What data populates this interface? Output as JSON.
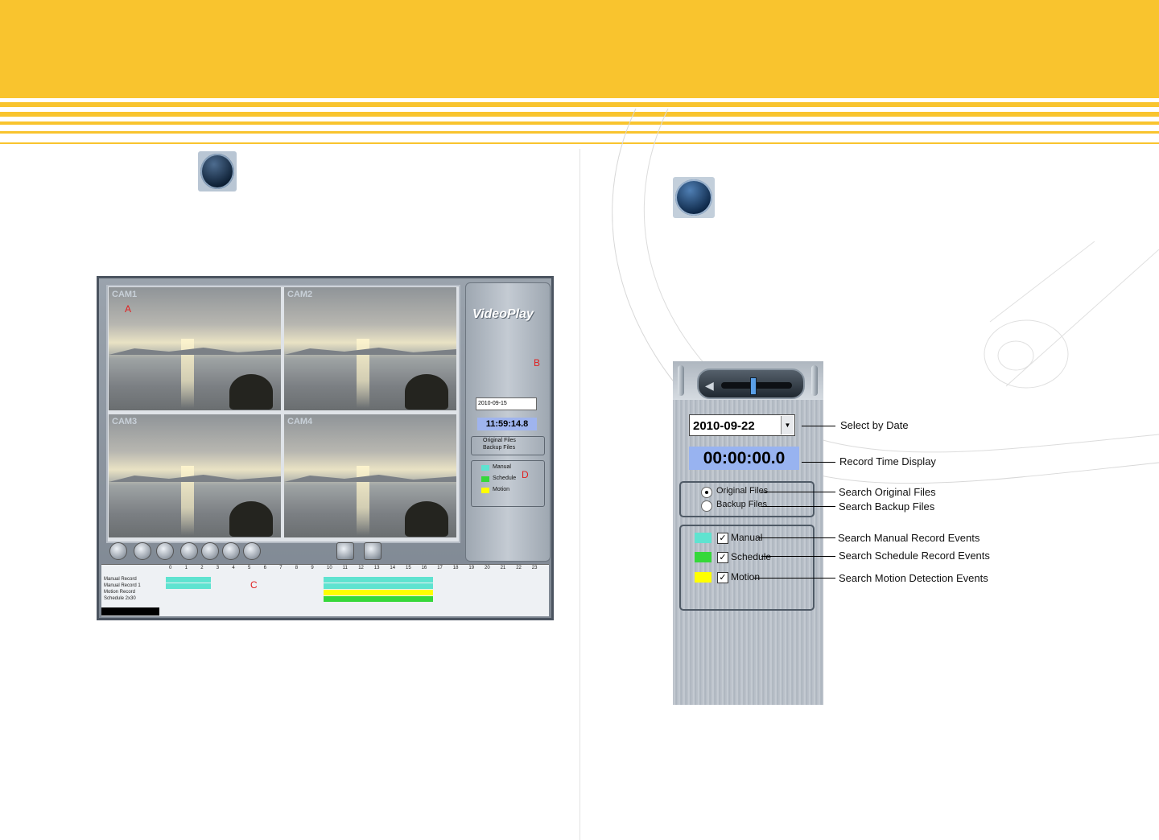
{
  "colors": {
    "header": "#f9c42e",
    "manual": "#5fe3d0",
    "schedule": "#35d83a",
    "motion": "#ffff00",
    "time_bg": "#98b3f0"
  },
  "icons": {
    "search": "playback-search-icon",
    "back": "return-icon"
  },
  "screenshot": {
    "cameras": [
      "CAM1",
      "CAM2",
      "CAM3",
      "CAM4"
    ],
    "logo": "VideoPlay",
    "date": "2010-09-15",
    "time": "11:59:14.8",
    "files": [
      "Original Files",
      "Backup Files"
    ],
    "events": [
      "Manual",
      "Schedule",
      "Motion"
    ],
    "timeline_rows": [
      "Manual Record",
      "Manual Record 1",
      "Motion Record",
      "Schedule 2x30"
    ],
    "hours": [
      "0",
      "1",
      "2",
      "3",
      "4",
      "5",
      "6",
      "7",
      "8",
      "9",
      "10",
      "11",
      "12",
      "13",
      "14",
      "15",
      "16",
      "17",
      "18",
      "19",
      "20",
      "21",
      "22",
      "23"
    ],
    "markers": {
      "a": "A",
      "b": "B",
      "c": "C",
      "d": "D"
    }
  },
  "panel": {
    "date": "2010-09-22",
    "time": "00:00:00.0",
    "original": "Original Files",
    "backup": "Backup Files",
    "manual": "Manual",
    "schedule": "Schedule",
    "motion": "Motion",
    "check": "✓"
  },
  "callouts": {
    "select_date": "Select by Date",
    "record_time": "Record Time Display",
    "search_original": "Search Original Files",
    "search_backup": "Search Backup Files",
    "search_manual": "Search Manual Record Events",
    "search_schedule": "Search Schedule Record Events",
    "search_motion": "Search Motion Detection Events"
  }
}
